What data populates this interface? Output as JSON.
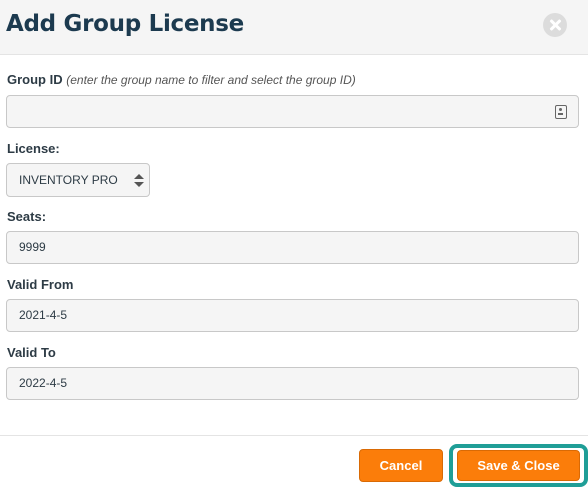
{
  "dialog": {
    "title": "Add Group License"
  },
  "form": {
    "group_id": {
      "label": "Group ID",
      "hint": "(enter the group name to filter and select the group ID)",
      "value": ""
    },
    "license": {
      "label": "License:",
      "selected": "INVENTORY PRO"
    },
    "seats": {
      "label": "Seats:",
      "value": "9999"
    },
    "valid_from": {
      "label": "Valid From",
      "value": "2021-4-5"
    },
    "valid_to": {
      "label": "Valid To",
      "value": "2022-4-5"
    }
  },
  "footer": {
    "cancel_label": "Cancel",
    "save_label": "Save & Close"
  },
  "colors": {
    "button": "#fb7d0a",
    "focus_ring": "#1f9e97",
    "title": "#1c3a4f"
  },
  "icons": {
    "close": "close-icon",
    "id_card": "id-card-icon",
    "select_arrows": "sort-arrows-icon"
  }
}
